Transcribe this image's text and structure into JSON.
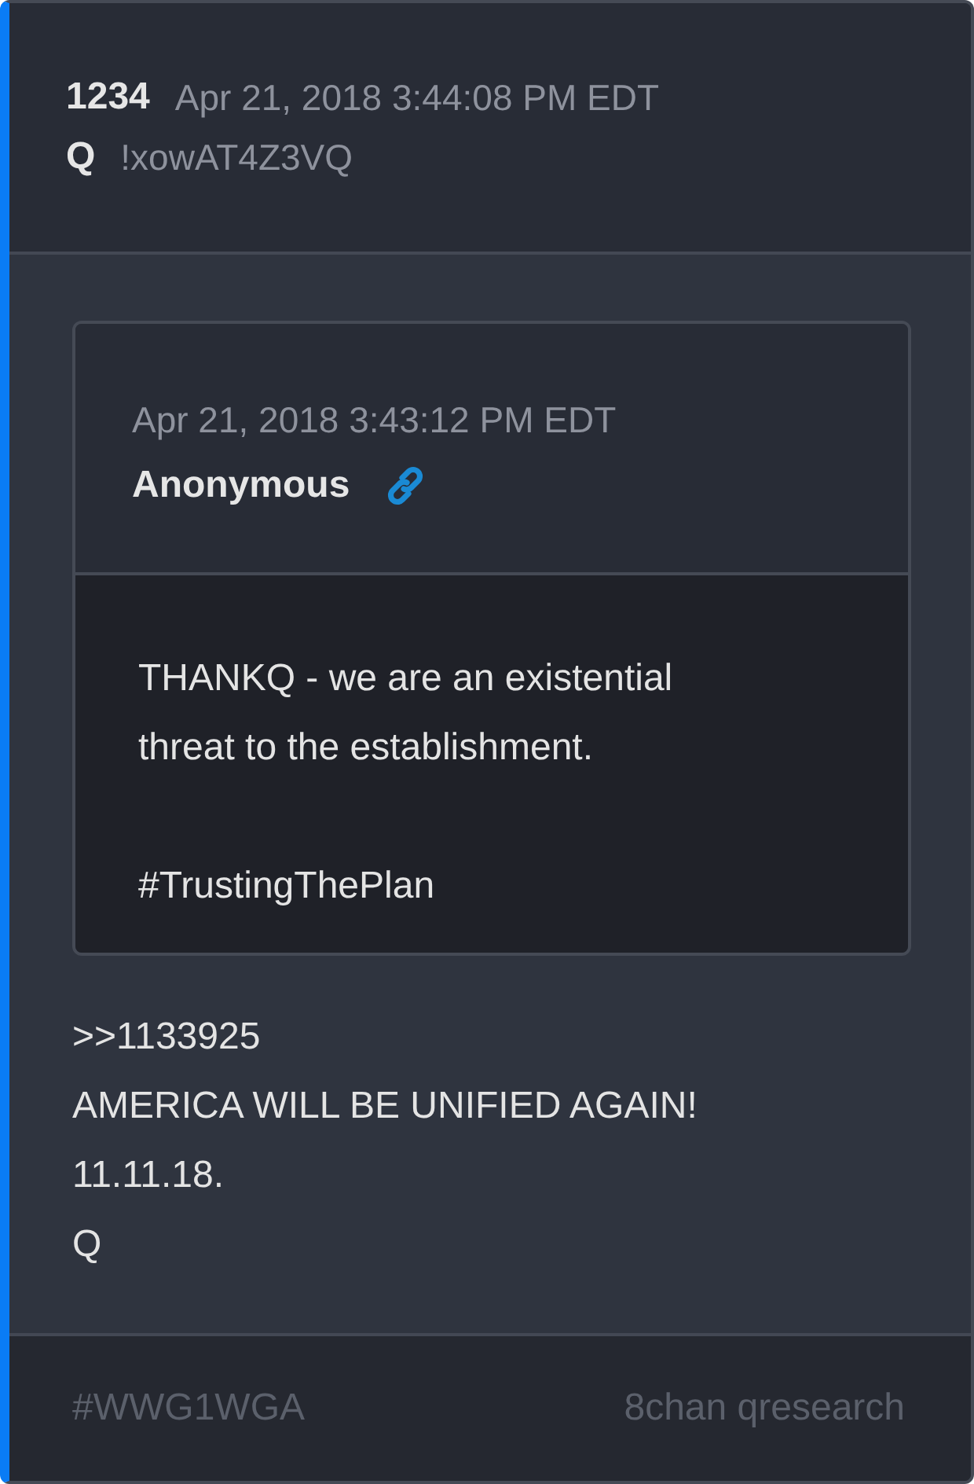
{
  "post": {
    "number": "1234",
    "timestamp": "Apr 21, 2018 3:44:08 PM EDT",
    "author": "Q",
    "tripcode": "!xowAT4Z3VQ"
  },
  "quote": {
    "timestamp": "Apr 21, 2018 3:43:12 PM EDT",
    "author": "Anonymous",
    "text": "THANKQ - we are an existential\nthreat to the establishment.\n\n#TrustingThePlan"
  },
  "message": ">>1133925\nAMERICA WILL BE UNIFIED AGAIN!\n11.11.18.\nQ",
  "footer": {
    "hashtag": "#WWG1WGA",
    "source": "8chan qresearch"
  }
}
